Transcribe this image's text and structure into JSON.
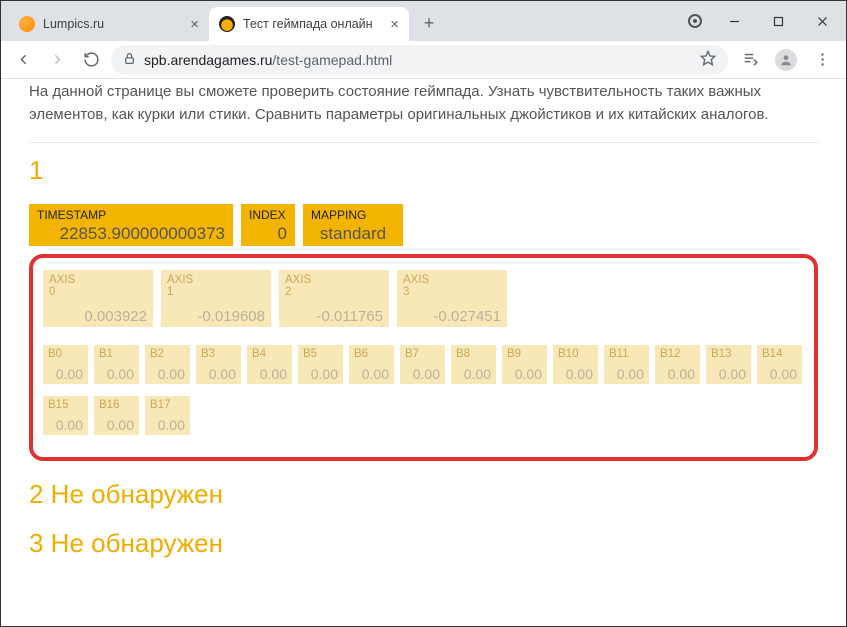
{
  "browser": {
    "tabs": [
      {
        "title": "Lumpics.ru",
        "active": false
      },
      {
        "title": "Тест геймпада онлайн",
        "active": true
      }
    ],
    "url_host": "spb.arendagames.ru",
    "url_path": "/test-gamepad.html"
  },
  "page": {
    "intro": "На данной странице вы сможете проверить состояние геймпада. Узнать чувствительность таких важных элементов, как курки или стики. Сравнить параметры оригинальных джойстиков и их китайских аналогов.",
    "gamepad1": {
      "number": "1",
      "timestamp_label": "TIMESTAMP",
      "timestamp_value": "22853.900000000373",
      "index_label": "INDEX",
      "index_value": "0",
      "mapping_label": "MAPPING",
      "mapping_value": "standard",
      "axes": [
        {
          "label": "AXIS",
          "idx": "0",
          "value": "0.003922"
        },
        {
          "label": "AXIS",
          "idx": "1",
          "value": "-0.019608"
        },
        {
          "label": "AXIS",
          "idx": "2",
          "value": "-0.011765"
        },
        {
          "label": "AXIS",
          "idx": "3",
          "value": "-0.027451"
        }
      ],
      "buttons": [
        {
          "l": "B0",
          "v": "0.00"
        },
        {
          "l": "B1",
          "v": "0.00"
        },
        {
          "l": "B2",
          "v": "0.00"
        },
        {
          "l": "B3",
          "v": "0.00"
        },
        {
          "l": "B4",
          "v": "0.00"
        },
        {
          "l": "B5",
          "v": "0.00"
        },
        {
          "l": "B6",
          "v": "0.00"
        },
        {
          "l": "B7",
          "v": "0.00"
        },
        {
          "l": "B8",
          "v": "0.00"
        },
        {
          "l": "B9",
          "v": "0.00"
        },
        {
          "l": "B10",
          "v": "0.00"
        },
        {
          "l": "B11",
          "v": "0.00"
        },
        {
          "l": "B12",
          "v": "0.00"
        },
        {
          "l": "B13",
          "v": "0.00"
        },
        {
          "l": "B14",
          "v": "0.00"
        },
        {
          "l": "B15",
          "v": "0.00"
        },
        {
          "l": "B16",
          "v": "0.00"
        },
        {
          "l": "B17",
          "v": "0.00"
        }
      ]
    },
    "gamepad2_heading": "2 Не обнаружен",
    "gamepad3_heading": "3 Не обнаружен"
  }
}
